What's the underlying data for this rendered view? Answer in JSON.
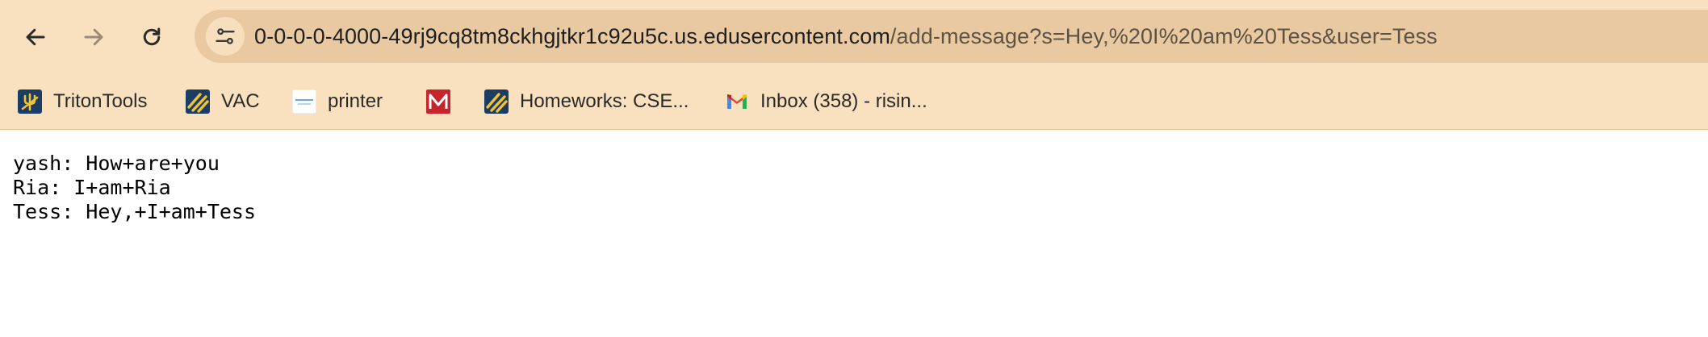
{
  "browser": {
    "url_host": "0-0-0-0-4000-49rj9cq8tm8ckhgjtkr1c92u5c.us.edusercontent.com",
    "url_rest": "/add-message?s=Hey,%20I%20am%20Tess&user=Tess",
    "icons": {
      "back": "arrow-left-icon",
      "forward": "arrow-right-icon",
      "reload": "reload-icon",
      "site_info": "tune-icon"
    },
    "colors": {
      "toolbar": "#f9e0be",
      "omnibox": "#e8c9a1"
    }
  },
  "bookmarks": [
    {
      "label": "TritonTools",
      "icon": "trident-icon"
    },
    {
      "label": "VAC",
      "icon": "stripes-icon"
    },
    {
      "label": "printer",
      "icon": "wifi-print-icon"
    },
    {
      "label": "",
      "icon": "mcgraw-hill-icon"
    },
    {
      "label": "Homeworks: CSE...",
      "icon": "stripes-icon"
    },
    {
      "label": "Inbox (358) - risin...",
      "icon": "gmail-icon"
    }
  ],
  "messages": [
    "yash: How+are+you",
    "Ria: I+am+Ria",
    "Tess: Hey,+I+am+Tess"
  ]
}
